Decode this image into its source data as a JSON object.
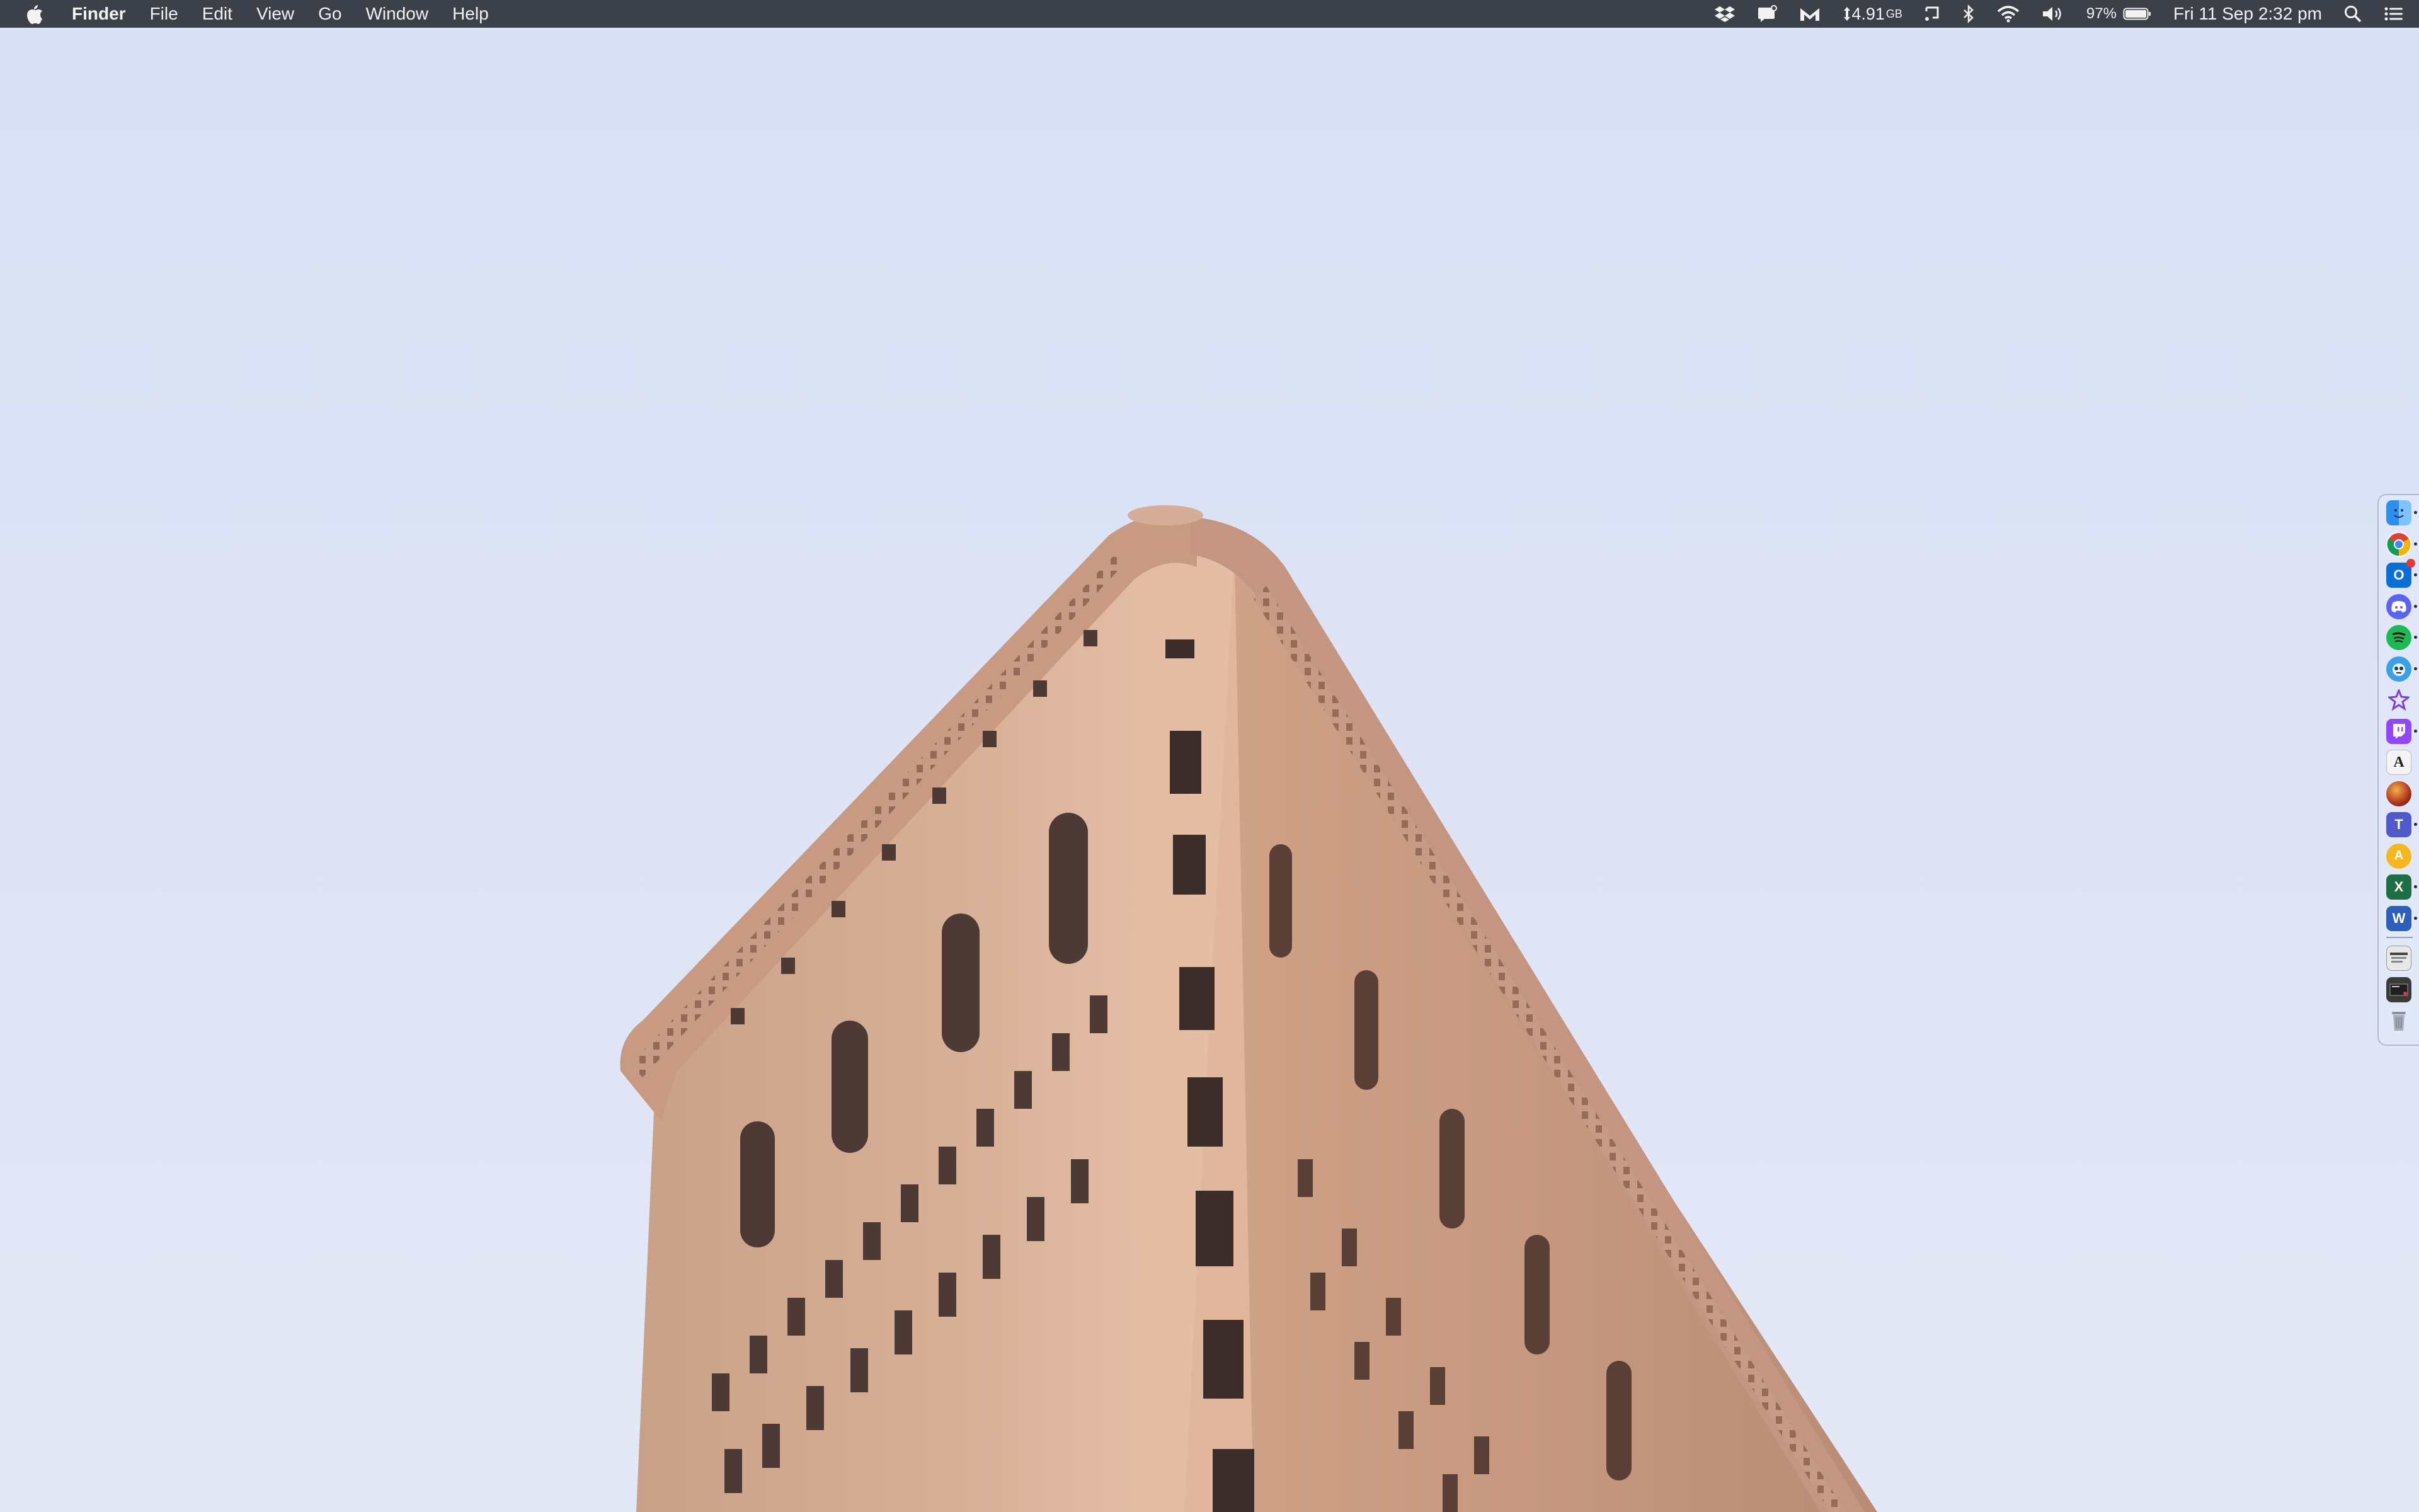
{
  "menubar": {
    "app_name": "Finder",
    "menus": [
      "File",
      "Edit",
      "View",
      "Go",
      "Window",
      "Help"
    ],
    "status": {
      "disk_size": "4.91",
      "disk_unit": "GB",
      "battery_percent": "97%",
      "clock": "Fri 11 Sep  2:32 pm"
    },
    "icons": [
      "apple-icon",
      "dropbox-icon",
      "notification-icon",
      "mimestream-icon",
      "disk-icon",
      "cast-icon",
      "bluetooth-icon",
      "wifi-icon",
      "volume-icon",
      "battery-icon",
      "spotlight-icon",
      "control-center-icon"
    ]
  },
  "desktop": {
    "wallpaper": "Flatiron Building against a pale blue sky"
  },
  "dock": {
    "position": "right",
    "apps": [
      {
        "name": "Finder",
        "icon": "finder-icon",
        "color": "#2f8ff0",
        "running": true
      },
      {
        "name": "Google Chrome",
        "icon": "chrome-icon",
        "color": "#ffffff",
        "running": true
      },
      {
        "name": "Microsoft Outlook",
        "icon": "outlook-icon",
        "color": "#0a6fd6",
        "running": true,
        "badge": true
      },
      {
        "name": "Discord",
        "icon": "discord-icon",
        "color": "#5865f2",
        "running": true
      },
      {
        "name": "Spotify",
        "icon": "spotify-icon",
        "color": "#1db954",
        "running": true
      },
      {
        "name": "Tweetbot",
        "icon": "tweetbot-icon",
        "color": "#3aa0e8",
        "running": true
      },
      {
        "name": "Reeder",
        "icon": "star-icon",
        "color": "#7b3fe4",
        "running": false
      },
      {
        "name": "Twitch",
        "icon": "twitch-icon",
        "color": "#9146ff",
        "running": true
      },
      {
        "name": "Dictionary",
        "icon": "dictionary-icon",
        "color": "#f4f4f4",
        "running": false
      },
      {
        "name": "Game",
        "icon": "game-icon",
        "color": "#b53a1e",
        "running": false
      },
      {
        "name": "Microsoft Teams",
        "icon": "teams-icon",
        "color": "#5059c9",
        "running": true
      },
      {
        "name": "Amphetamine",
        "icon": "amphetamine-icon",
        "color": "#f5b81c",
        "running": false
      },
      {
        "name": "Microsoft Excel",
        "icon": "excel-icon",
        "color": "#1d7044",
        "running": true
      },
      {
        "name": "Microsoft Word",
        "icon": "word-icon",
        "color": "#2b5fb9",
        "running": true
      }
    ],
    "others": [
      {
        "name": "Recent Documents",
        "icon": "stack-icon",
        "color": "#e8e8e8"
      },
      {
        "name": "Downloads",
        "icon": "downloads-stack-icon",
        "color": "#3a3a3a"
      },
      {
        "name": "Trash",
        "icon": "trash-icon",
        "color": "#9aa0aa"
      }
    ]
  }
}
